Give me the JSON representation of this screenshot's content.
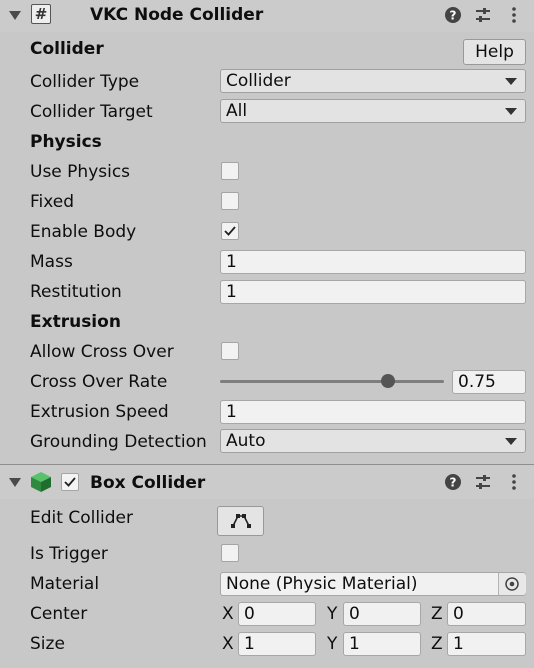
{
  "vkc": {
    "title": "VKC Node Collider",
    "script_icon": "#",
    "section_collider": "Collider",
    "help_label": "Help",
    "collider_type": {
      "label": "Collider Type",
      "value": "Collider"
    },
    "collider_target": {
      "label": "Collider Target",
      "value": "All"
    },
    "section_physics": "Physics",
    "use_physics": {
      "label": "Use Physics",
      "checked": false
    },
    "fixed": {
      "label": "Fixed",
      "checked": false
    },
    "enable_body": {
      "label": "Enable Body",
      "checked": true
    },
    "mass": {
      "label": "Mass",
      "value": "1"
    },
    "restitution": {
      "label": "Restitution",
      "value": "1"
    },
    "section_extrusion": "Extrusion",
    "allow_cross_over": {
      "label": "Allow Cross Over",
      "checked": false
    },
    "cross_over_rate": {
      "label": "Cross Over Rate",
      "value": "0.75",
      "slider_fraction": 0.75
    },
    "extrusion_speed": {
      "label": "Extrusion Speed",
      "value": "1"
    },
    "grounding_detection": {
      "label": "Grounding Detection",
      "value": "Auto"
    }
  },
  "box": {
    "title": "Box Collider",
    "enabled": true,
    "edit_collider_label": "Edit Collider",
    "is_trigger": {
      "label": "Is Trigger",
      "checked": false
    },
    "material": {
      "label": "Material",
      "value": "None (Physic Material)"
    },
    "center": {
      "label": "Center",
      "x": "0",
      "y": "0",
      "z": "0"
    },
    "size": {
      "label": "Size",
      "x": "1",
      "y": "1",
      "z": "1"
    }
  },
  "axis_labels": {
    "x": "X",
    "y": "Y",
    "z": "Z"
  },
  "colors": {
    "panel_bg": "#c8c8c8",
    "field_bg": "#f1f1f1",
    "box_icon_green": "#2f8a3f"
  },
  "icons": [
    "foldout-arrow-icon",
    "script-icon",
    "help-icon",
    "presets-icon",
    "kebab-menu-icon",
    "cube-icon",
    "checkmark-icon",
    "edit-bounds-icon",
    "object-picker-icon"
  ]
}
